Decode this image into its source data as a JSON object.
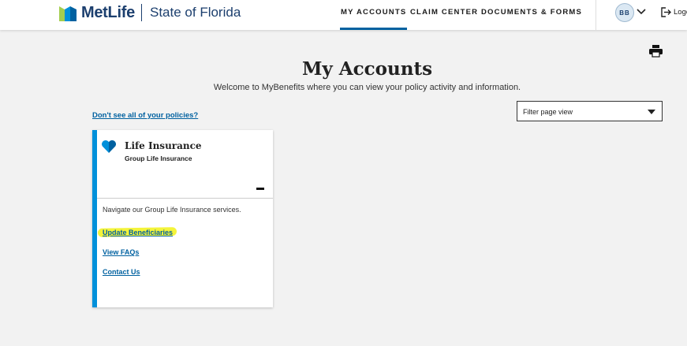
{
  "header": {
    "brand": "MetLife",
    "org": "State of Florida",
    "nav": [
      "MY ACCOUNTS",
      "CLAIM CENTER",
      "DOCUMENTS & FORMS"
    ],
    "avatar_initials": "BB",
    "logout_label": "Logo",
    "brand_colors": {
      "green": "#a4ce4e",
      "blue": "#0090da",
      "navy": "#1c3f6e"
    }
  },
  "page": {
    "title": "My Accounts",
    "welcome": "Welcome to MyBenefits where you can view your policy activity and information.",
    "missing_policies_link": "Don't see all of your policies?",
    "filter_placeholder": "Filter page view"
  },
  "card": {
    "title": "Life Insurance",
    "subtitle": "Group Life Insurance",
    "description": "Navigate our Group Life Insurance services.",
    "links": [
      "Update Beneficiaries",
      "View FAQs",
      "Contact Us"
    ],
    "accent_color": "#0090da",
    "highlight_color": "#f4f43a"
  },
  "icons": [
    "metlife-logo-icon",
    "chevron-down-icon",
    "logout-icon",
    "print-icon",
    "heart-icon",
    "collapse-icon"
  ]
}
